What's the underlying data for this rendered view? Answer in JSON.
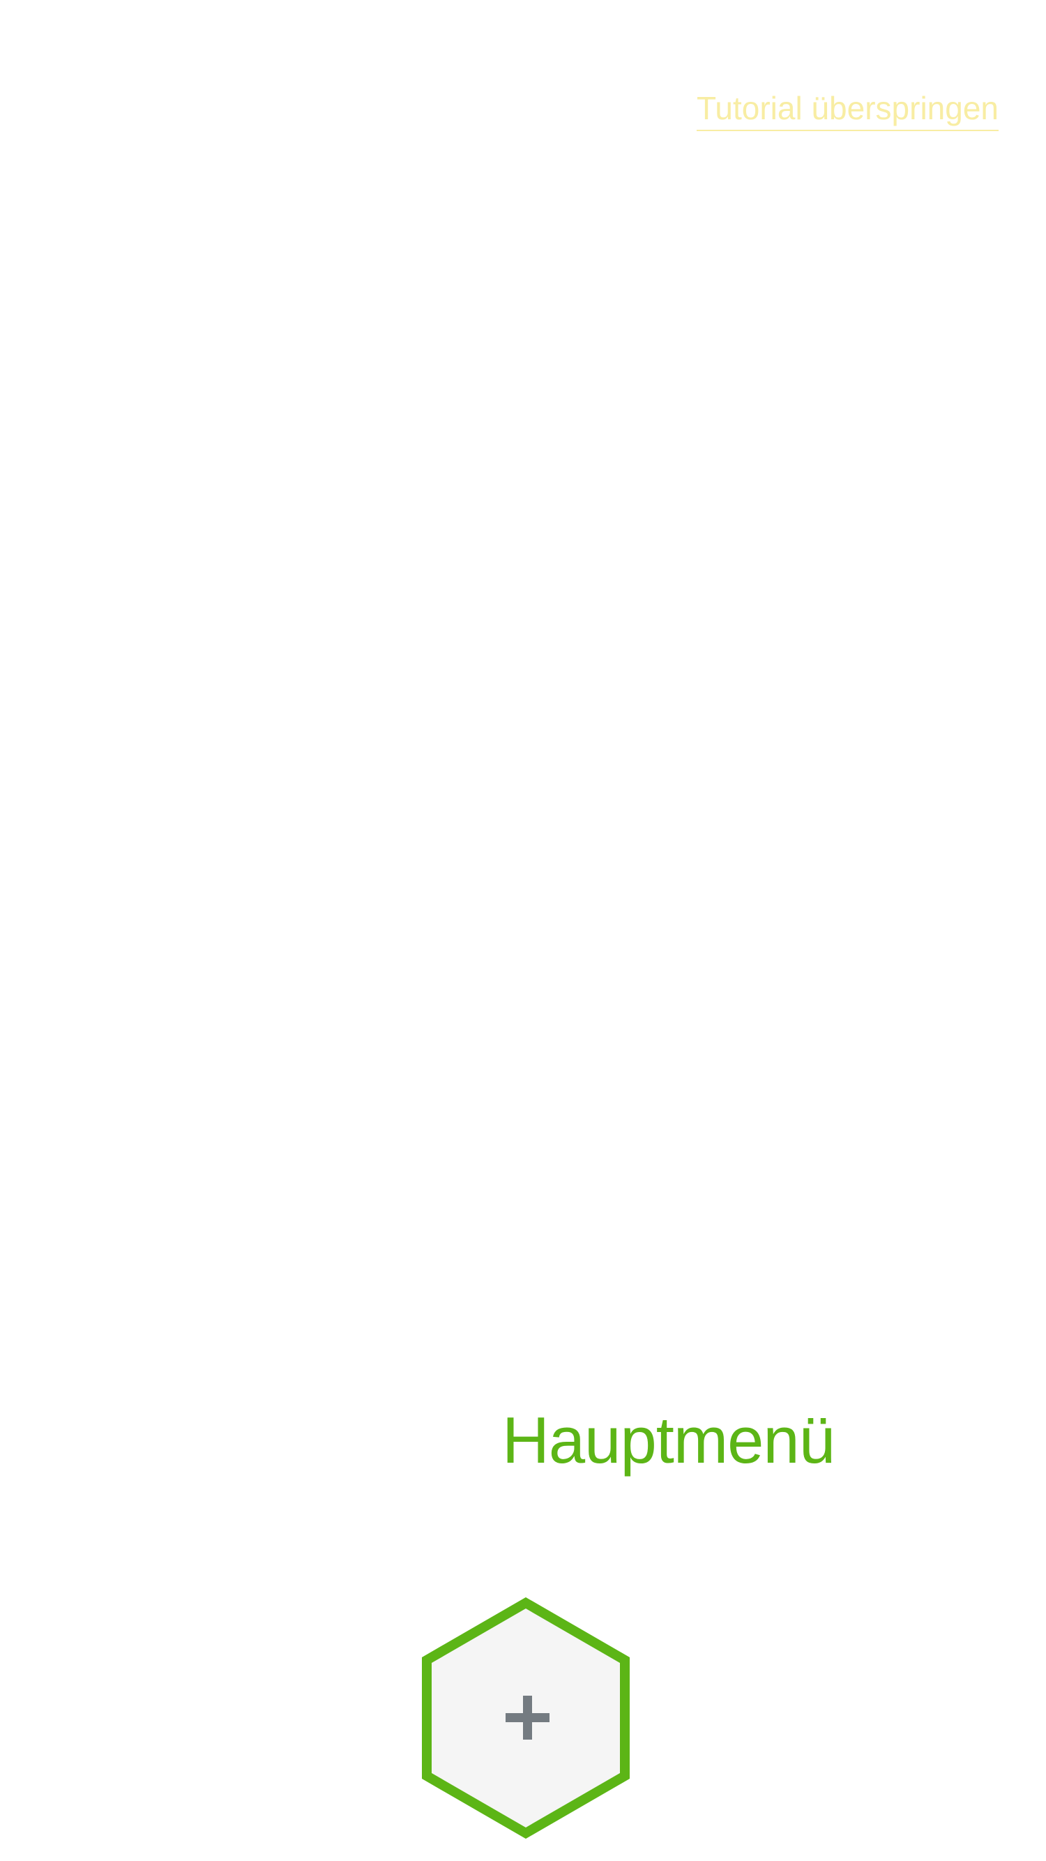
{
  "tutorial": {
    "skip_label": "Tutorial überspringen"
  },
  "menu": {
    "title": "Hauptmenü"
  },
  "add_button": {
    "icon": "plus-icon",
    "shape": "hexagon"
  },
  "colors": {
    "accent_green": "#5cb516",
    "skip_link_yellow": "#f8eda3",
    "hex_fill": "#f5f5f5",
    "plus_gray": "#747b81",
    "background": "#ffffff"
  }
}
